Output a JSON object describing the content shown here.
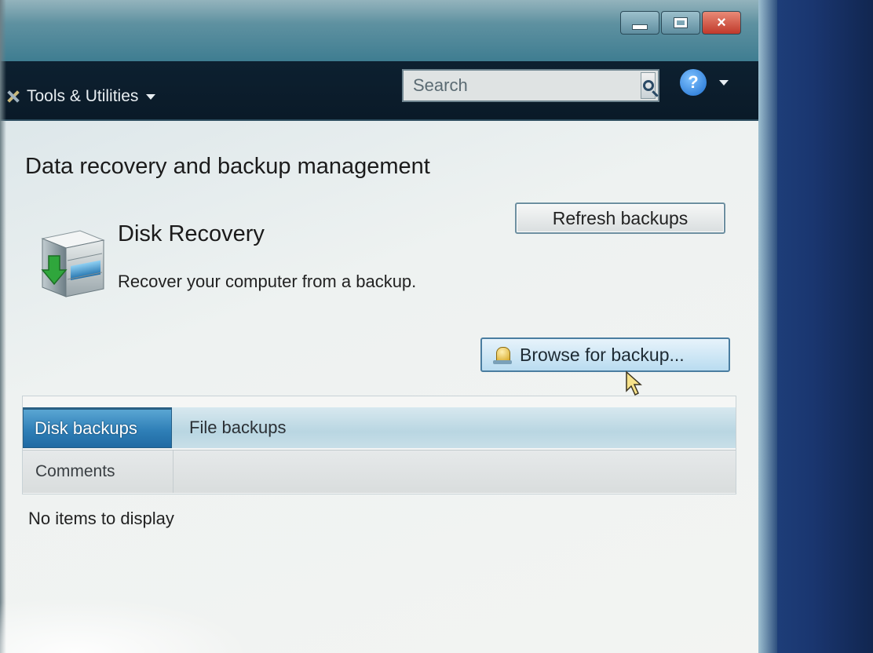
{
  "window": {
    "controls": {
      "minimize": "minimize",
      "maximize": "maximize",
      "close": "×"
    }
  },
  "toolbar": {
    "menu_label": "Tools & Utilities",
    "search": {
      "placeholder": "Search",
      "value": ""
    },
    "help_glyph": "?"
  },
  "content": {
    "heading": "Data recovery and backup management",
    "refresh_button": "Refresh backups",
    "disk_recovery": {
      "title": "Disk Recovery",
      "description": "Recover your computer from a backup."
    },
    "browse_button": "Browse for backup...",
    "tabs": [
      {
        "label": "Disk backups",
        "active": true
      },
      {
        "label": "File backups",
        "active": false
      }
    ],
    "columns": [
      "Comments"
    ],
    "empty_message": "No items to display"
  },
  "colors": {
    "titlebar": "#5b8f9f",
    "toolbar": "#0d2030",
    "active_tab": "#2f7fb7",
    "desktop": "#1e3f7a"
  },
  "icons": [
    "tools-icon",
    "magnifier-icon",
    "help-icon",
    "disk-recovery-icon",
    "browse-icon",
    "mouse-cursor-icon"
  ]
}
